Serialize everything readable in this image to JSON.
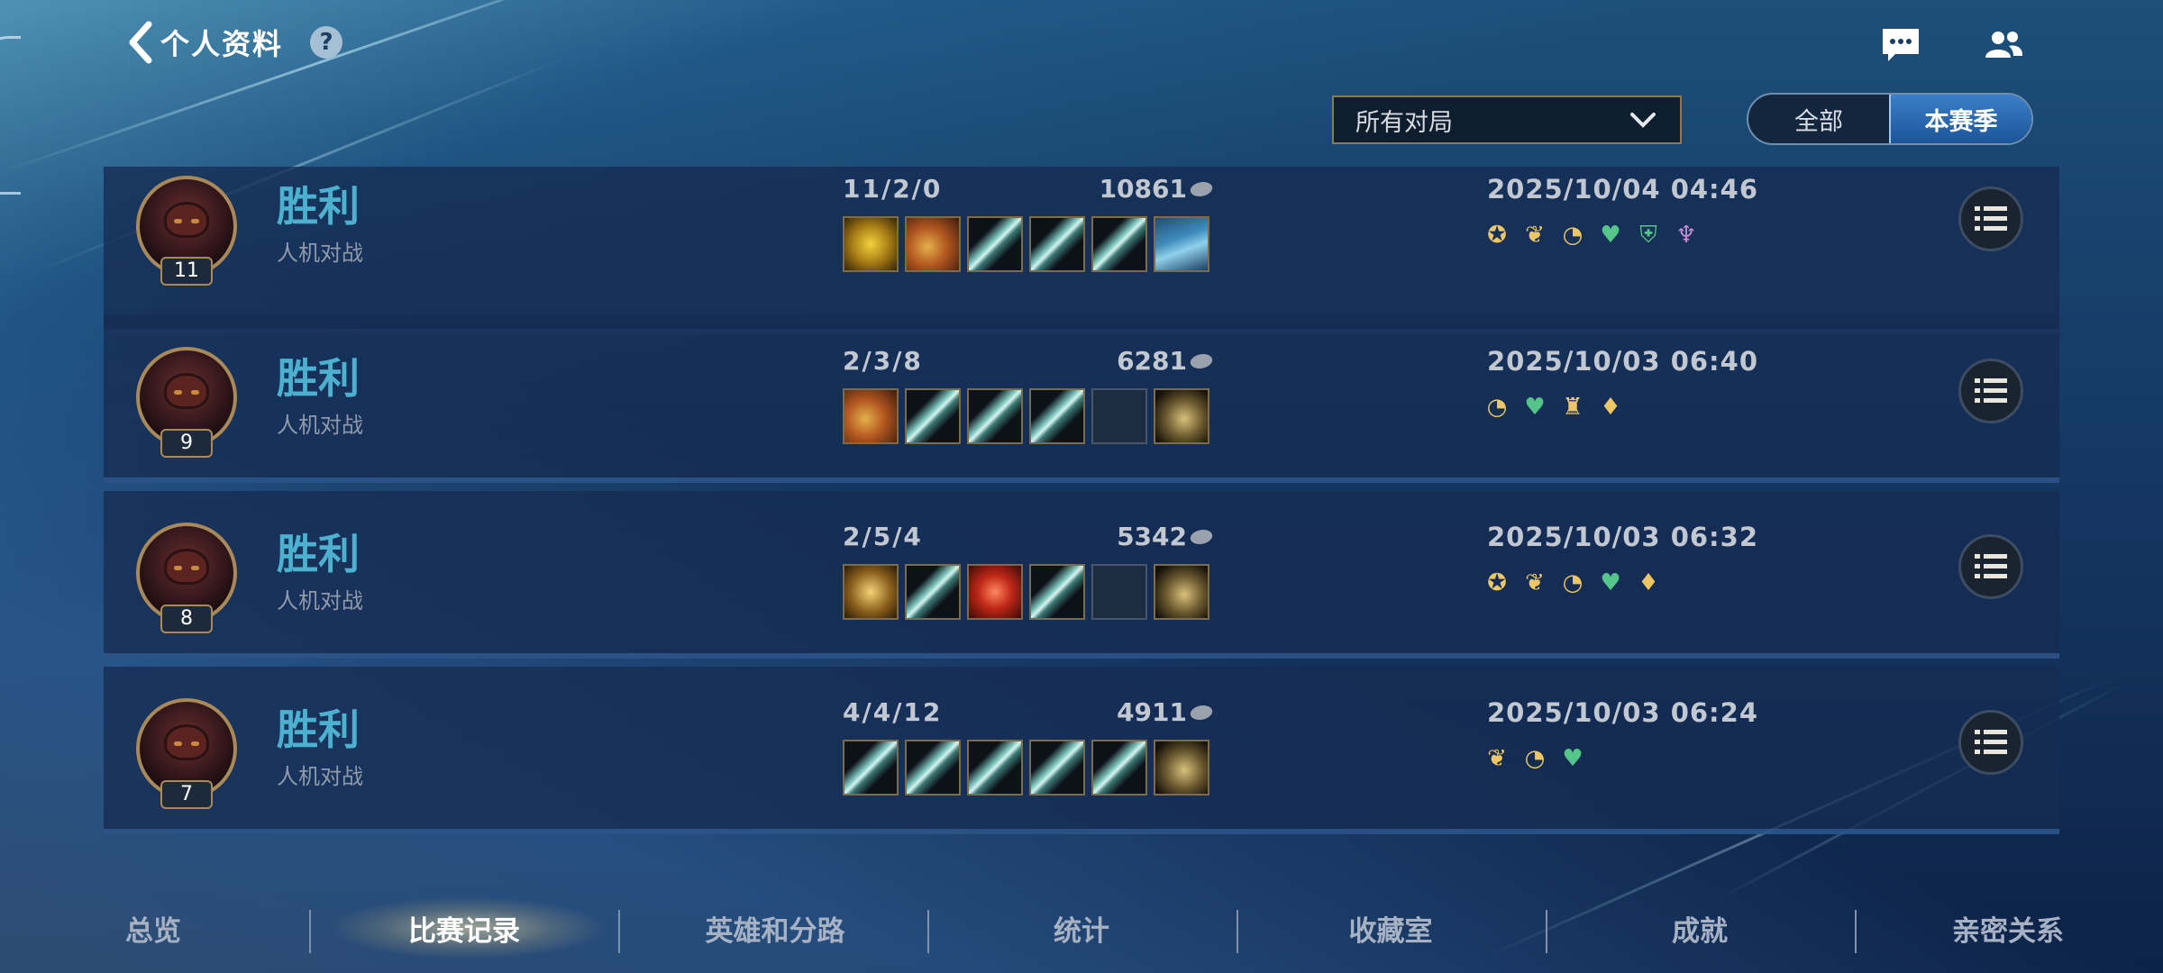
{
  "header": {
    "title": "个人资料",
    "help_glyph": "?"
  },
  "filter": {
    "selected": "所有对局"
  },
  "season_toggle": {
    "options": [
      "全部",
      "本赛季"
    ],
    "selected": "本赛季"
  },
  "colors": {
    "result_win": "#4eb0cf",
    "accent_gold": "#a8895a",
    "toggle_active": "#2a6db5"
  },
  "matches": [
    {
      "result": "胜利",
      "mode": "人机对战",
      "level": "11",
      "kda": "11/2/0",
      "gold": "10861",
      "date": "2025/10/04 04:46",
      "items": [
        "gold-triangle-item",
        "cannon-item",
        "blade-item",
        "blade-item",
        "blade-item",
        "wave-cape-item"
      ],
      "badges": [
        "yellow",
        "yellow",
        "yellow",
        "green",
        "green",
        "purple"
      ]
    },
    {
      "result": "胜利",
      "mode": "人机对战",
      "level": "9",
      "kda": "2/3/8",
      "gold": "6281",
      "date": "2025/10/03 06:40",
      "items": [
        "cannon-item",
        "blade-item",
        "blade-item",
        "blade-item",
        "empty-slot",
        "boots-item"
      ],
      "badges": [
        "yellow",
        "green",
        "yellow",
        "yellow"
      ]
    },
    {
      "result": "胜利",
      "mode": "人机对战",
      "level": "8",
      "kda": "2/5/4",
      "gold": "5342",
      "date": "2025/10/03 06:32",
      "items": [
        "cross-item",
        "blade-item",
        "red-orb-item",
        "blade-item",
        "empty-slot",
        "boots-item"
      ],
      "badges": [
        "yellow",
        "yellow",
        "yellow",
        "green",
        "yellow"
      ]
    },
    {
      "result": "胜利",
      "mode": "人机对战",
      "level": "7",
      "kda": "4/4/12",
      "gold": "4911",
      "date": "2025/10/03 06:24",
      "items": [
        "blade-item",
        "blade-item",
        "blade-item",
        "blade-item",
        "blade-item",
        "boots-item"
      ],
      "badges": [
        "yellow",
        "yellow",
        "green"
      ]
    }
  ],
  "bottom_nav": {
    "items": [
      "总览",
      "比赛记录",
      "英雄和分路",
      "统计",
      "收藏室",
      "成就",
      "亲密关系"
    ],
    "active": "比赛记录"
  }
}
